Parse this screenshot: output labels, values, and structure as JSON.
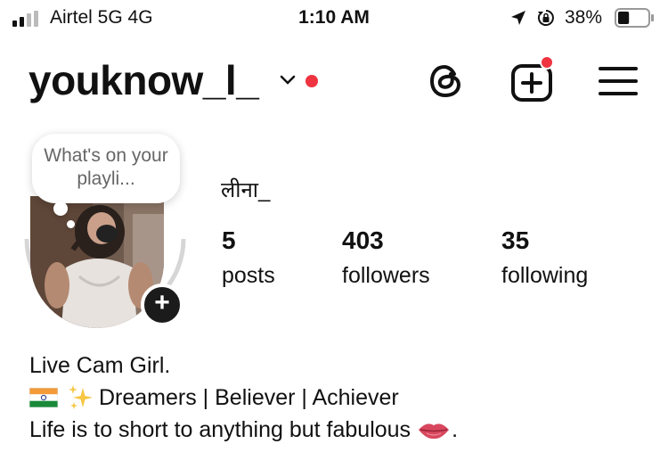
{
  "status_bar": {
    "carrier": "Airtel 5G  4G",
    "time": "1:10 AM",
    "battery_percent": "38%",
    "battery_level": 0.38,
    "icons": [
      "signal-icon",
      "location-arrow-icon",
      "rotation-lock-icon",
      "battery-icon"
    ]
  },
  "header": {
    "username": "youknow_l_",
    "icons": [
      "chevron-down-icon",
      "threads-icon",
      "create-post-icon",
      "menu-icon"
    ],
    "notification_color": "#ef3340"
  },
  "profile": {
    "note_text": "What's on your playli...",
    "display_name": "लीना_",
    "stats": [
      {
        "value": "5",
        "label": "posts"
      },
      {
        "value": "403",
        "label": "followers"
      },
      {
        "value": "35",
        "label": "following"
      }
    ],
    "add_story_icon": "plus-icon"
  },
  "bio": {
    "line1": "Live Cam Girl.",
    "line2": "Dreamers | Believer | Achiever",
    "line2_emojis": [
      "india-flag-icon",
      "sparkles-icon"
    ],
    "line3": "Life is to short to anything but fabulous",
    "line3_emoji": "lips-icon",
    "line3_end": "."
  }
}
